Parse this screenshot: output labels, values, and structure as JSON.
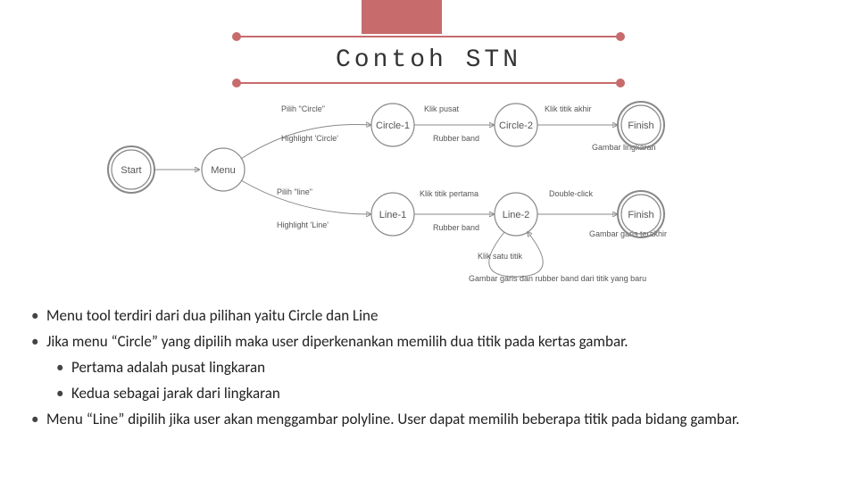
{
  "title": "Contoh STN",
  "diagram": {
    "nodes": {
      "start": "Start",
      "menu": "Menu",
      "circle1": "Circle-1",
      "circle2": "Circle-2",
      "finish1": "Finish",
      "line1": "Line-1",
      "line2": "Line-2",
      "finish2": "Finish"
    },
    "edges": {
      "menu_to_c1_a": "Pilih \"Circle\"",
      "menu_to_c1_b": "Highlight 'Circle'",
      "c1_to_c2_a": "Klik pusat",
      "c1_to_c2_b": "Rubber band",
      "c2_to_f_a": "Klik titik akhir",
      "c2_to_f_b": "Gambar lingkaran",
      "menu_to_l1_a": "Pilih \"line\"",
      "menu_to_l1_b": "Highlight 'Line'",
      "l1_to_l2_a": "Klik titik pertama",
      "l1_to_l2_b": "Rubber band",
      "l2_to_f_a": "Double-click",
      "l2_to_f_b": "Gambar garis terakhir",
      "l2_loop": "Klik satu titik",
      "l2_loop_b": "Gambar garis dan rubber band dari titik yang baru"
    }
  },
  "bullets": {
    "b1": "Menu tool terdiri dari dua pilihan yaitu Circle dan Line",
    "b2": "Jika menu  “Circle”  yang dipilih maka user diperkenankan memilih dua titik pada kertas gambar.",
    "b2a": "Pertama adalah pusat lingkaran",
    "b2b": "Kedua sebagai jarak dari lingkaran",
    "b3": "Menu  “Line”  dipilih jika user akan menggambar polyline. User dapat memilih beberapa titik pada bidang gambar."
  }
}
